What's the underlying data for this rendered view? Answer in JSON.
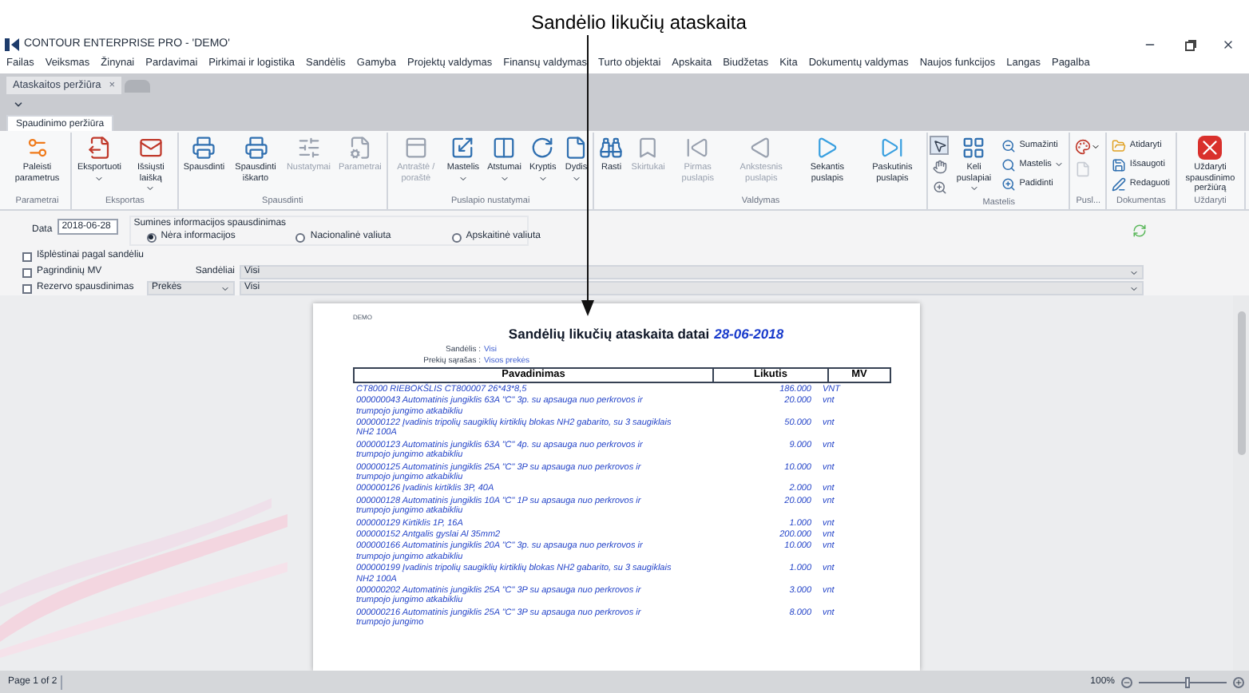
{
  "annotation": {
    "text": "Sandėlio likučių ataskaita"
  },
  "window": {
    "title": "CONTOUR ENTERPRISE PRO - 'DEMO'"
  },
  "menu": [
    "Failas",
    "Veiksmas",
    "Žinynai",
    "Pardavimai",
    "Pirkimai ir logistika",
    "Sandėlis",
    "Gamyba",
    "Projektų valdymas",
    "Finansų valdymas",
    "Turto objektai",
    "Apskaita",
    "Biudžetas",
    "Kita",
    "Dokumentų valdymas",
    "Naujos funkcijos",
    "Langas",
    "Pagalba"
  ],
  "doc_tabs": [
    {
      "label": "Ataskaitos peržiūra",
      "close": "×",
      "selected": true
    }
  ],
  "ribbon_tabs": [
    {
      "label": "Spaudinimo peržiūra",
      "selected": true
    }
  ],
  "ribbon_groups": [
    {
      "label": "Parametrai",
      "items": [
        {
          "kind": "large",
          "label": "Paleisti parametrus",
          "disabled": false,
          "dropdown": false
        }
      ]
    },
    {
      "label": "Eksportas",
      "items": [
        {
          "kind": "large",
          "label": "Eksportuoti",
          "disabled": false,
          "dropdown": true
        },
        {
          "kind": "large",
          "label": "Išsiųsti laišką",
          "disabled": false,
          "dropdown": true
        }
      ]
    },
    {
      "label": "Spausdinti",
      "items": [
        {
          "kind": "large",
          "label": "Spausdinti",
          "disabled": false,
          "dropdown": false
        },
        {
          "kind": "large",
          "label": "Spausdinti iškarto",
          "disabled": false,
          "dropdown": false
        },
        {
          "kind": "large",
          "label": "Nustatymai",
          "disabled": true,
          "dropdown": false
        },
        {
          "kind": "large",
          "label": "Parametrai",
          "disabled": true,
          "dropdown": false
        }
      ]
    },
    {
      "label": "Puslapio nustatymai",
      "items": [
        {
          "kind": "large",
          "label": "Antraštė / poraštė",
          "disabled": true,
          "dropdown": false
        },
        {
          "kind": "large",
          "label": "Mastelis",
          "disabled": false,
          "dropdown": true
        },
        {
          "kind": "large",
          "label": "Atstumai",
          "disabled": false,
          "dropdown": true
        },
        {
          "kind": "large",
          "label": "Kryptis",
          "disabled": false,
          "dropdown": true
        },
        {
          "kind": "large",
          "label": "Dydis",
          "disabled": false,
          "dropdown": true
        }
      ]
    },
    {
      "label": "Valdymas",
      "items": [
        {
          "kind": "large",
          "label": "Rasti",
          "disabled": false,
          "dropdown": false
        },
        {
          "kind": "large",
          "label": "Skirtukai",
          "disabled": true,
          "dropdown": false
        },
        {
          "kind": "large",
          "label": "Pirmas puslapis",
          "disabled": true,
          "dropdown": false
        },
        {
          "kind": "large",
          "label": "Ankstesnis puslapis",
          "disabled": true,
          "dropdown": false
        },
        {
          "kind": "large",
          "label": "Sekantis puslapis",
          "disabled": false,
          "dropdown": false
        },
        {
          "kind": "large",
          "label": "Paskutinis puslapis",
          "disabled": false,
          "dropdown": false
        }
      ]
    },
    {
      "label": "Mastelis",
      "items": [
        {
          "kind": "tool",
          "selected": true
        },
        {
          "kind": "tool",
          "selected": false
        },
        {
          "kind": "tool",
          "selected": false
        },
        {
          "kind": "large",
          "label": "Keli puslapiai",
          "disabled": false,
          "dropdown": true
        },
        {
          "kind": "small",
          "label": "Sumažinti",
          "disabled": false,
          "dropdown": false
        },
        {
          "kind": "small",
          "label": "Mastelis",
          "disabled": false,
          "dropdown": true
        },
        {
          "kind": "small",
          "label": "Padidinti",
          "disabled": false,
          "dropdown": false
        }
      ]
    },
    {
      "label": "Pusl...",
      "items": [
        {
          "kind": "icon",
          "disabled": false,
          "dropdown": true
        },
        {
          "kind": "icon",
          "disabled": true,
          "dropdown": false
        }
      ]
    },
    {
      "label": "Dokumentas",
      "items": [
        {
          "kind": "small",
          "label": "Atidaryti",
          "disabled": false,
          "dropdown": false
        },
        {
          "kind": "small",
          "label": "Išsaugoti",
          "disabled": false,
          "dropdown": false
        },
        {
          "kind": "small",
          "label": "Redaguoti",
          "disabled": false,
          "dropdown": false
        }
      ]
    },
    {
      "label": "Uždaryti",
      "items": [
        {
          "kind": "large",
          "label": "Uždaryti spausdinimo peržiūrą",
          "disabled": false,
          "dropdown": false
        }
      ]
    }
  ],
  "options": {
    "date_label": "Data",
    "date": "2018-06-28",
    "summary": {
      "legend": "Sumines informacijos spausdinimas",
      "radios": [
        {
          "label": "Nėra informacijos",
          "selected": true
        },
        {
          "label": "Nacionalinė valiuta",
          "selected": false
        },
        {
          "label": "Apskaitinė valiuta",
          "selected": false
        }
      ]
    },
    "checkboxes": [
      {
        "label": "Išplėstinai pagal sandėliu",
        "checked": false
      },
      {
        "label": "Pagrindinių MV",
        "checked": false
      },
      {
        "label": "Rezervo spausdinimas",
        "checked": false
      }
    ],
    "warehouses_label": "Sandėliai",
    "warehouses": "Visi",
    "goods_type": "Prekės",
    "goods": "Visi"
  },
  "report": {
    "company": "DEMO",
    "title": "Sandėlių likučių ataskaita datai",
    "date": "28-06-2018",
    "filters": [
      {
        "label": "Sandėlis :",
        "value": "Visi"
      },
      {
        "label": "Prekių sąrašas :",
        "value": "Visos prekės"
      }
    ],
    "columns": [
      "Pavadinimas",
      "Likutis",
      "MV"
    ],
    "rows": [
      {
        "name": "CT8000 RIEBOKŠLIS CT800007 26*43*8,5",
        "qty": "186.000",
        "unit": "VNT"
      },
      {
        "name": "000000043 Automatinis jungiklis 63A \"C\" 3p. su apsauga nuo perkrovos ir trumpojo jungimo atkabikliu",
        "qty": "20.000",
        "unit": "vnt"
      },
      {
        "name": "000000122 Įvadinis tripolių saugiklių kirtiklių blokas NH2 gabarito, su 3 saugiklais NH2 100A",
        "qty": "50.000",
        "unit": "vnt"
      },
      {
        "name": "000000123 Automatinis jungiklis 63A \"C\" 4p. su apsauga nuo perkrovos ir trumpojo jungimo atkabikliu",
        "qty": "9.000",
        "unit": "vnt"
      },
      {
        "name": "000000125 Automatinis jungiklis 25A \"C\" 3P su apsauga nuo perkrovos ir trumpojo jungimo atkabikliu",
        "qty": "10.000",
        "unit": "vnt"
      },
      {
        "name": "000000126 Įvadinis kirtiklis 3P, 40A",
        "qty": "2.000",
        "unit": "vnt"
      },
      {
        "name": "000000128 Automatinis jungiklis 10A \"C\" 1P su apsauga nuo perkrovos ir trumpojo jungimo atkabikliu",
        "qty": "20.000",
        "unit": "vnt"
      },
      {
        "name": "000000129 Kirtiklis 1P, 16A",
        "qty": "1.000",
        "unit": "vnt"
      },
      {
        "name": "000000152 Antgalis gyslai Al 35mm2",
        "qty": "200.000",
        "unit": "vnt"
      },
      {
        "name": "000000166 Automatinis jungiklis 20A \"C\" 3p. su apsauga nuo perkrovos ir trumpojo jungimo atkabikliu",
        "qty": "10.000",
        "unit": "vnt"
      },
      {
        "name": "000000199 Įvadinis tripolių saugiklių kirtiklių blokas NH2 gabarito, su 3 saugiklais NH2 100A",
        "qty": "1.000",
        "unit": "vnt"
      },
      {
        "name": "000000202 Automatinis jungiklis 25A \"C\" 3P su apsauga nuo perkrovos ir trumpojo jungimo atkabikliu",
        "qty": "3.000",
        "unit": "vnt"
      },
      {
        "name": "000000216 Automatinis jungiklis 25A \"C\" 3P su apsauga nuo perkrovos ir trumpojo jungimo",
        "qty": "8.000",
        "unit": "vnt"
      }
    ]
  },
  "status": {
    "page": "Page 1 of 2",
    "zoom": "100%",
    "level": 0.55
  }
}
